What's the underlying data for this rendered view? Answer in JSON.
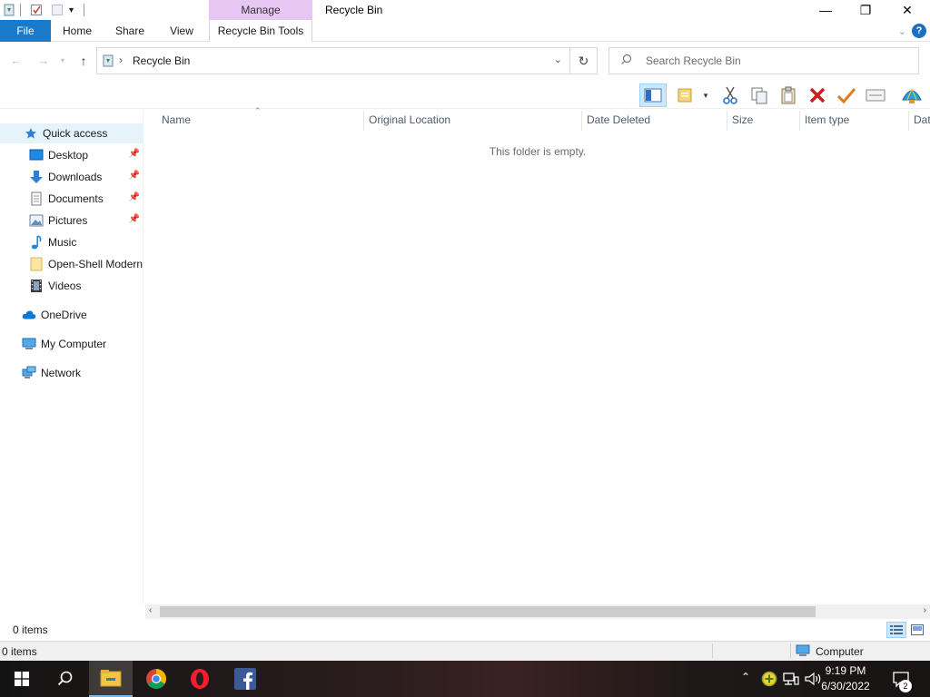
{
  "window": {
    "title": "Recycle Bin",
    "context_tab_group": "Manage",
    "min_label": "—",
    "max_label": "❐",
    "close_label": "✕"
  },
  "ribbon": {
    "tabs": [
      {
        "label": "File"
      },
      {
        "label": "Home"
      },
      {
        "label": "Share"
      },
      {
        "label": "View"
      },
      {
        "label": "Recycle Bin Tools"
      }
    ],
    "help_label": "?"
  },
  "address": {
    "path": "Recycle Bin",
    "separator": "›",
    "search_placeholder": "Search Recycle Bin"
  },
  "nav": {
    "quick_access": "Quick access",
    "items": [
      {
        "label": "Desktop",
        "pinned": true
      },
      {
        "label": "Downloads",
        "pinned": true
      },
      {
        "label": "Documents",
        "pinned": true
      },
      {
        "label": "Pictures",
        "pinned": true
      },
      {
        "label": "Music",
        "pinned": false
      },
      {
        "label": "Open-Shell Modern",
        "pinned": false
      },
      {
        "label": "Videos",
        "pinned": false
      }
    ],
    "onedrive": "OneDrive",
    "my_computer": "My Computer",
    "network": "Network"
  },
  "columns": [
    "Name",
    "Original Location",
    "Date Deleted",
    "Size",
    "Item type",
    "Dat"
  ],
  "empty_message": "This folder is empty.",
  "status": {
    "items_count": "0 items",
    "bottom_items": "0 items",
    "location": "Computer"
  },
  "taskbar": {
    "time": "9:19 PM",
    "date": "6/30/2022",
    "notification_count": "2"
  },
  "colors": {
    "file_tab": "#1979ca",
    "manage_tab": "#e7c6f3",
    "selection": "#cce8ff",
    "delete_red": "#d01c1c"
  }
}
